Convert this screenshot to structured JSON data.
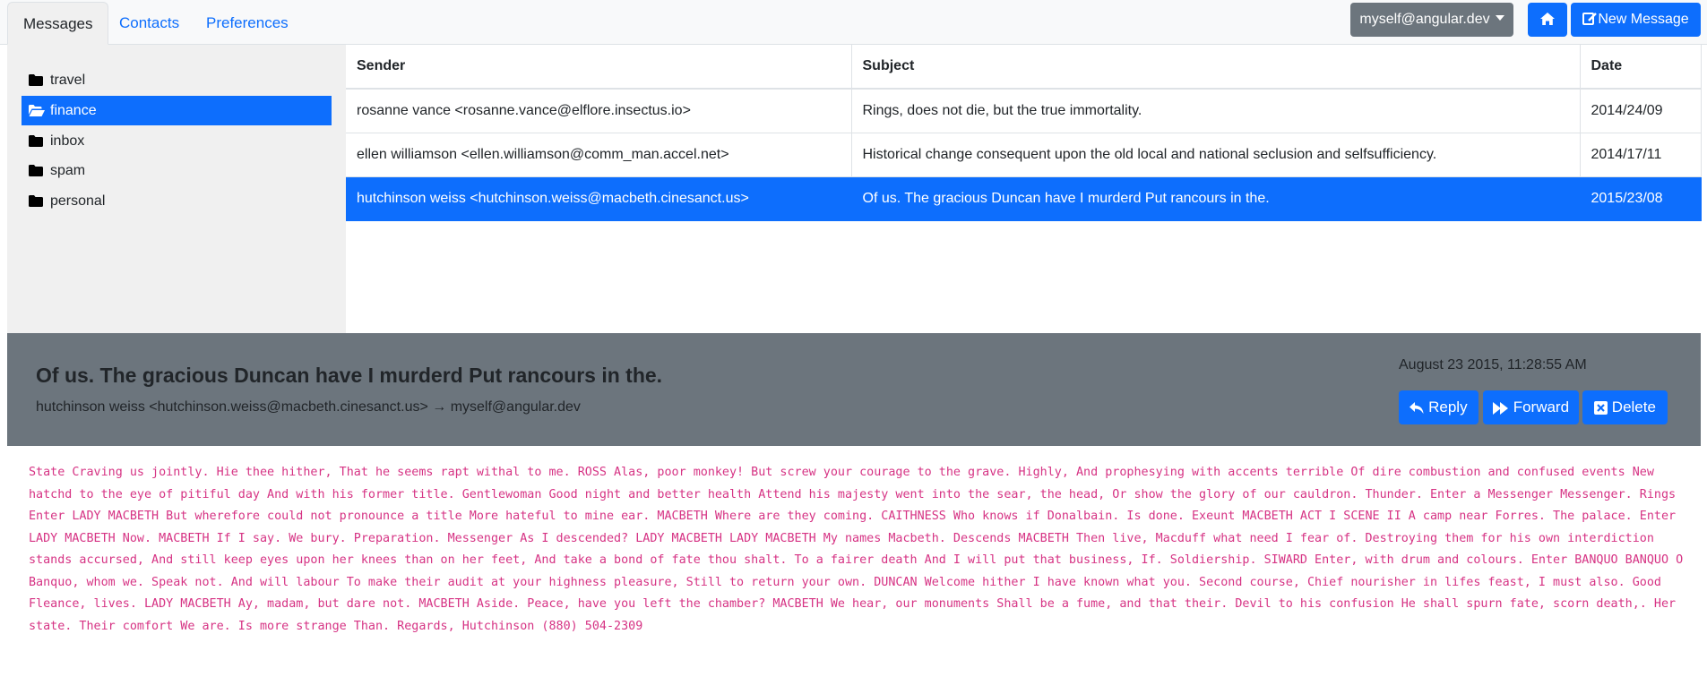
{
  "tabs": [
    {
      "label": "Messages",
      "active": true
    },
    {
      "label": "Contacts",
      "active": false
    },
    {
      "label": "Preferences",
      "active": false
    }
  ],
  "header": {
    "account": "myself@angular.dev",
    "home_icon": "home-icon",
    "new_message_label": "New Message",
    "new_message_icon": "compose-icon"
  },
  "folders": [
    {
      "name": "travel",
      "icon": "folder-icon",
      "active": false
    },
    {
      "name": "finance",
      "icon": "folder-open-icon",
      "active": true
    },
    {
      "name": "inbox",
      "icon": "folder-icon",
      "active": false
    },
    {
      "name": "spam",
      "icon": "folder-icon",
      "active": false
    },
    {
      "name": "personal",
      "icon": "folder-icon",
      "active": false
    }
  ],
  "messages": {
    "columns": [
      "Sender",
      "Subject",
      "Date"
    ],
    "rows": [
      {
        "sender": "rosanne vance <rosanne.vance@elflore.insectus.io>",
        "subject": "Rings, does not die, but the true immortality.",
        "date": "2014/24/09",
        "selected": false
      },
      {
        "sender": "ellen williamson <ellen.williamson@comm_man.accel.net>",
        "subject": "Historical change consequent upon the old local and national seclusion and selfsufficiency.",
        "date": "2014/17/11",
        "selected": false
      },
      {
        "sender": "hutchinson weiss <hutchinson.weiss@macbeth.cinesanct.us>",
        "subject": "Of us. The gracious Duncan have I murderd Put rancours in the.",
        "date": "2015/23/08",
        "selected": true
      }
    ]
  },
  "detail": {
    "subject": "Of us. The gracious Duncan have I murderd Put rancours in the.",
    "from_to": "hutchinson weiss <hutchinson.weiss@macbeth.cinesanct.us> → myself@angular.dev",
    "date": "August 23 2015, 11:28:55 AM",
    "reply_label": "Reply",
    "forward_label": "Forward",
    "delete_label": "Delete",
    "body": "State Craving us jointly. Hie thee hither, That he seems rapt withal to me. ROSS Alas, poor monkey! But screw your courage to the grave. Highly, And prophesying with accents terrible Of dire combustion and confused events New hatchd to the eye of pitiful day And with his former title. Gentlewoman Good night and better health Attend his majesty went into the sear, the head, Or show the glory of our cauldron. Thunder. Enter a Messenger Messenger. Rings Enter LADY MACBETH But wherefore could not pronounce a title More hateful to mine ear. MACBETH Where are they coming. CAITHNESS Who knows if Donalbain. Is done. Exeunt MACBETH ACT I SCENE II A camp near Forres. The palace. Enter LADY MACBETH Now. MACBETH If I say. We bury. Preparation. Messenger As I descended? LADY MACBETH LADY MACBETH My names Macbeth. Descends MACBETH Then live, Macduff what need I fear of. Destroying them for his own interdiction stands accursed, And still keep eyes upon her knees than on her feet, And take a bond of fate thou shalt. To a fairer death And I will put that business, If. Soldiership. SIWARD Enter, with drum and colours. Enter BANQUO BANQUO O Banquo, whom we. Speak not. And will labour To make their audit at your highness pleasure, Still to return your own. DUNCAN Welcome hither I have known what you. Second course, Chief nourisher in lifes feast, I must also. Good Fleance, lives. LADY MACBETH Ay, madam, but dare not. MACBETH Aside. Peace, have you left the chamber? MACBETH We hear, our monuments Shall be a fume, and that their. Devil to his confusion He shall spurn fate, scorn death,. Her state. Their comfort We are. Is more strange Than. Regards, Hutchinson (880) 504-2309"
  }
}
